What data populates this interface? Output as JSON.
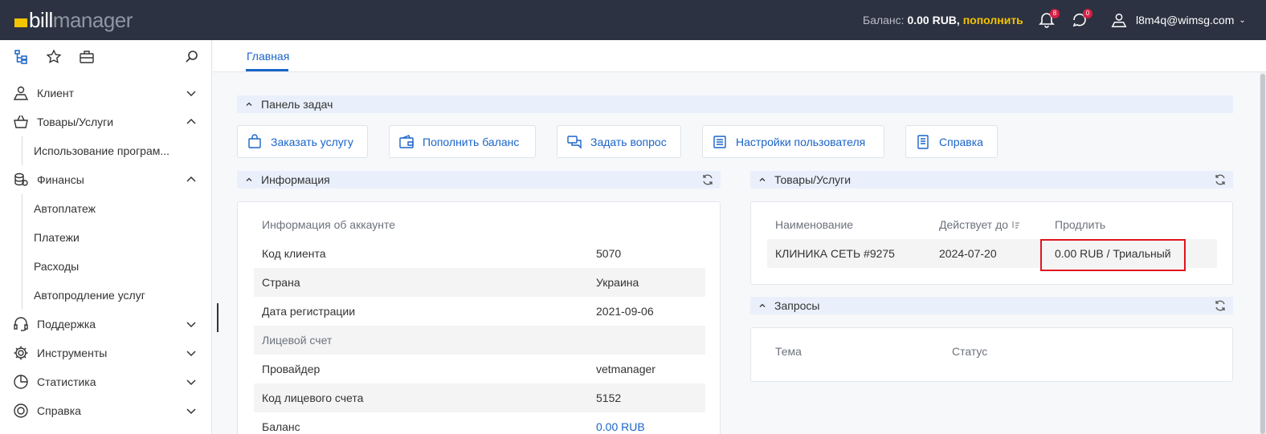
{
  "app": {
    "logo_bill": "bill",
    "logo_manager": "manager",
    "accent": "#f5c400",
    "link_color": "#1a64c8"
  },
  "topbar": {
    "balance_label": "Баланс:",
    "balance_value": "0.00 RUB,",
    "topup_link": "пополнить",
    "notifications_count": "8",
    "support_count": "0",
    "user_email": "l8m4q@wimsg.com"
  },
  "sidebar": {
    "items": [
      {
        "label": "Клиент",
        "icon": "client-icon"
      },
      {
        "label": "Товары/Услуги",
        "icon": "basket-icon",
        "sub": [
          "Использование програм..."
        ]
      },
      {
        "label": "Финансы",
        "icon": "coins-icon",
        "sub": [
          "Автоплатеж",
          "Платежи",
          "Расходы",
          "Автопродление услуг"
        ]
      },
      {
        "label": "Поддержка",
        "icon": "headset-icon"
      },
      {
        "label": "Инструменты",
        "icon": "gear-icon"
      },
      {
        "label": "Статистика",
        "icon": "pie-chart-icon"
      },
      {
        "label": "Справка",
        "icon": "lifebuoy-icon"
      }
    ]
  },
  "tabs": {
    "main": "Главная"
  },
  "taskbar": {
    "title": "Панель задач",
    "buttons": [
      "Заказать услугу",
      "Пополнить баланс",
      "Задать вопрос",
      "Настройки пользователя",
      "Справка"
    ]
  },
  "info": {
    "title": "Информация",
    "rows": [
      {
        "key": "Информация об аккаунте",
        "value": ""
      },
      {
        "key": "Код клиента",
        "value": "5070"
      },
      {
        "key": "Страна",
        "value": "Украина"
      },
      {
        "key": "Дата регистрации",
        "value": "2021-09-06"
      },
      {
        "key": "Лицевой счет",
        "value": ""
      },
      {
        "key": "Провайдер",
        "value": "vetmanager"
      },
      {
        "key": "Код лицевого счета",
        "value": "5152"
      },
      {
        "key": "Баланс",
        "value": "0.00 RUB"
      }
    ]
  },
  "services": {
    "title": "Товары/Услуги",
    "columns": [
      "Наименование",
      "Действует до",
      "Продлить"
    ],
    "rows": [
      {
        "name": "КЛИНИКА СЕТЬ #9275",
        "expires": "2024-07-20",
        "renew": "0.00 RUB / Триальный"
      }
    ]
  },
  "requests": {
    "title": "Запросы",
    "columns": [
      "Тема",
      "Статус"
    ]
  }
}
